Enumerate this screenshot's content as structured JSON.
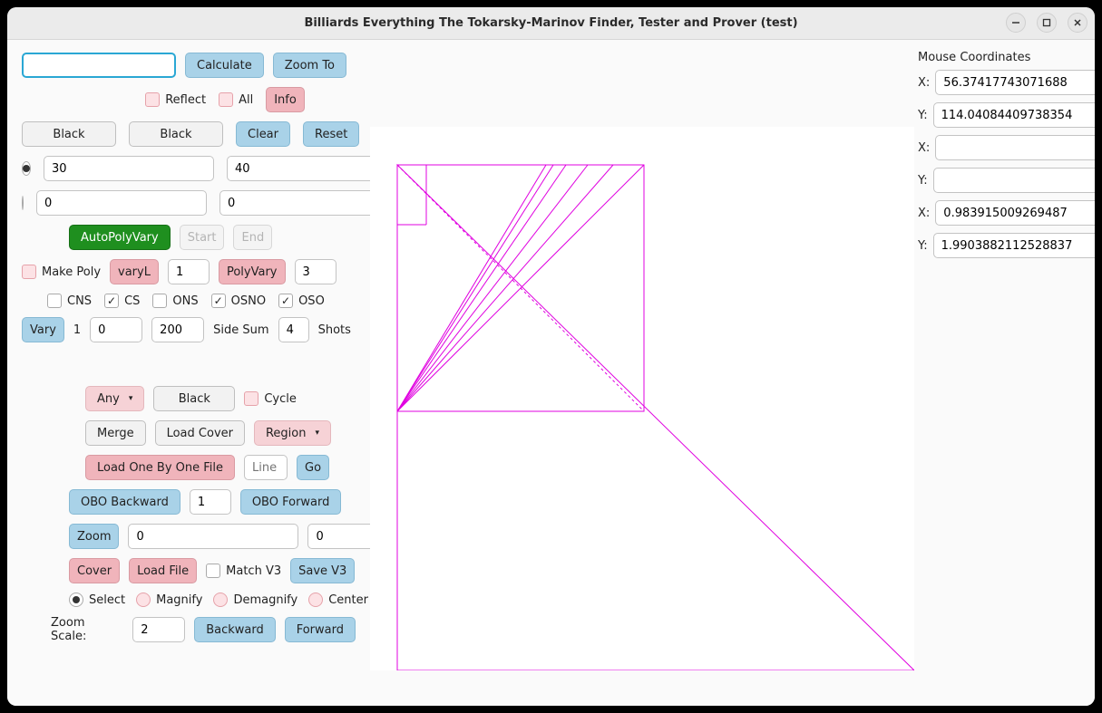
{
  "window": {
    "title": "Billiards Everything The Tokarsky-Marinov Finder, Tester and Prover (test)"
  },
  "left": {
    "main_input": "",
    "calculate": "Calculate",
    "zoom_to": "Zoom To",
    "reflect": "Reflect",
    "all": "All",
    "info": "Info",
    "black1": "Black",
    "black2": "Black",
    "clear": "Clear",
    "reset": "Reset",
    "angle1a": "30",
    "angle1b": "40",
    "angle2a": "0",
    "angle2b": "0",
    "autopolyvary": "AutoPolyVary",
    "start": "Start",
    "end": "End",
    "make_poly": "Make Poly",
    "varyL": "varyL",
    "varyL_val": "1",
    "polyvary": "PolyVary",
    "polyvary_val": "3",
    "cns": "CNS",
    "cs": "CS",
    "ons": "ONS",
    "osno": "OSNO",
    "oso": "OSO",
    "vary": "Vary",
    "vary_idx": "1",
    "vary_val": "0",
    "vary_val2": "200",
    "side_sum": "Side Sum",
    "side_sum_val": "4",
    "shots": "Shots",
    "any": "Any",
    "black3": "Black",
    "cycle": "Cycle",
    "merge": "Merge",
    "load_cover": "Load Cover",
    "region": "Region",
    "load_obo": "Load One By One File",
    "line_ph": "Line",
    "go": "Go",
    "obo_backward": "OBO Backward",
    "obo_val": "1",
    "obo_forward": "OBO Forward",
    "zoom": "Zoom",
    "zoom_val1": "0",
    "zoom_val2": "0",
    "cover": "Cover",
    "load_file": "Load File",
    "match_v3": "Match V3",
    "save_v3": "Save V3",
    "select": "Select",
    "magnify": "Magnify",
    "demagnify": "Demagnify",
    "center": "Center",
    "zoom_scale_label": "Zoom Scale:",
    "zoom_scale_val": "2",
    "backward": "Backward",
    "forward": "Forward"
  },
  "coords": {
    "title": "Mouse Coordinates",
    "x1": "56.37417743071688",
    "y1": "114.04084409738354",
    "x2": "",
    "y2": "",
    "x3": "0.983915009269487",
    "y3": "1.9903882112528837"
  }
}
